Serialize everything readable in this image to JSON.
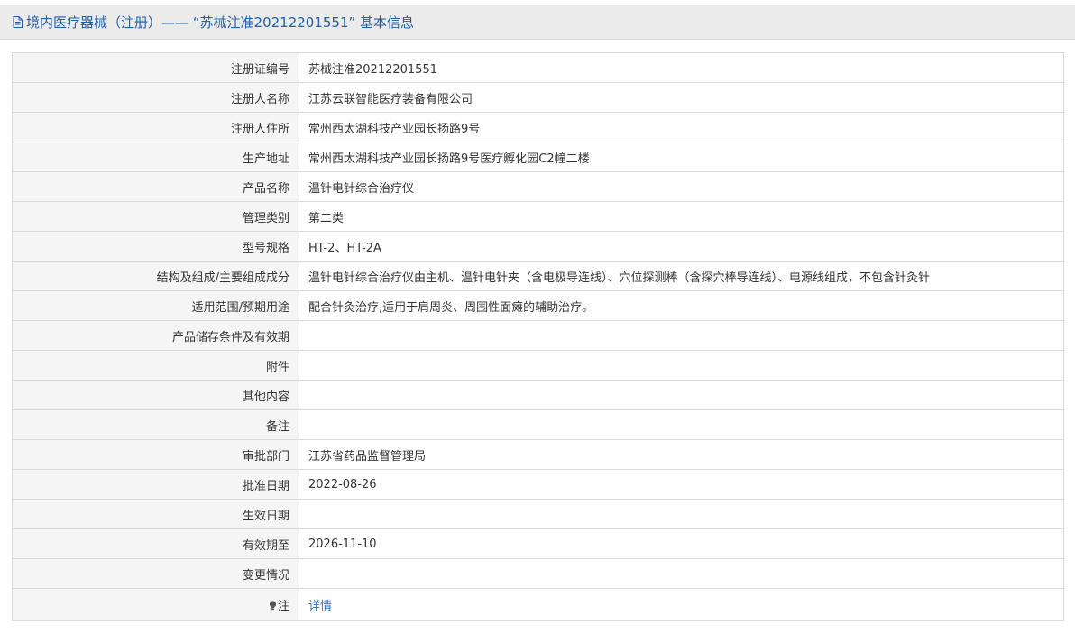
{
  "header": {
    "title": "境内医疗器械（注册）——  “苏械注准20212201551” 基本信息",
    "icon": "document-icon"
  },
  "rows": [
    {
      "label": "注册证编号",
      "value": "苏械注准20212201551"
    },
    {
      "label": "注册人名称",
      "value": "江苏云联智能医疗装备有限公司"
    },
    {
      "label": "注册人住所",
      "value": "常州西太湖科技产业园长扬路9号"
    },
    {
      "label": "生产地址",
      "value": "常州西太湖科技产业园长扬路9号医疗孵化园C2幢二楼"
    },
    {
      "label": "产品名称",
      "value": "温针电针综合治疗仪"
    },
    {
      "label": "管理类别",
      "value": "第二类"
    },
    {
      "label": "型号规格",
      "value": "HT-2、HT-2A"
    },
    {
      "label": "结构及组成/主要组成成分",
      "value": "温针电针综合治疗仪由主机、温针电针夹（含电极导连线）、穴位探测棒（含探穴棒导连线）、电源线组成，不包含针灸针"
    },
    {
      "label": "适用范围/预期用途",
      "value": "配合针灸治疗,适用于肩周炎、周围性面瘫的辅助治疗。"
    },
    {
      "label": "产品储存条件及有效期",
      "value": ""
    },
    {
      "label": "附件",
      "value": ""
    },
    {
      "label": "其他内容",
      "value": ""
    },
    {
      "label": "备注",
      "value": ""
    },
    {
      "label": "审批部门",
      "value": "江苏省药品监督管理局"
    },
    {
      "label": "批准日期",
      "value": "2022-08-26"
    },
    {
      "label": "生效日期",
      "value": ""
    },
    {
      "label": "有效期至",
      "value": "2026-11-10"
    },
    {
      "label": "变更情况",
      "value": ""
    }
  ],
  "note": {
    "label": "注",
    "icon": "lightbulb-icon",
    "link_text": "详情"
  },
  "colors": {
    "header_text": "#1f5ea8",
    "link": "#2a6cc4",
    "label_bg": "#f5f5f5",
    "border": "#d9d9d9"
  }
}
